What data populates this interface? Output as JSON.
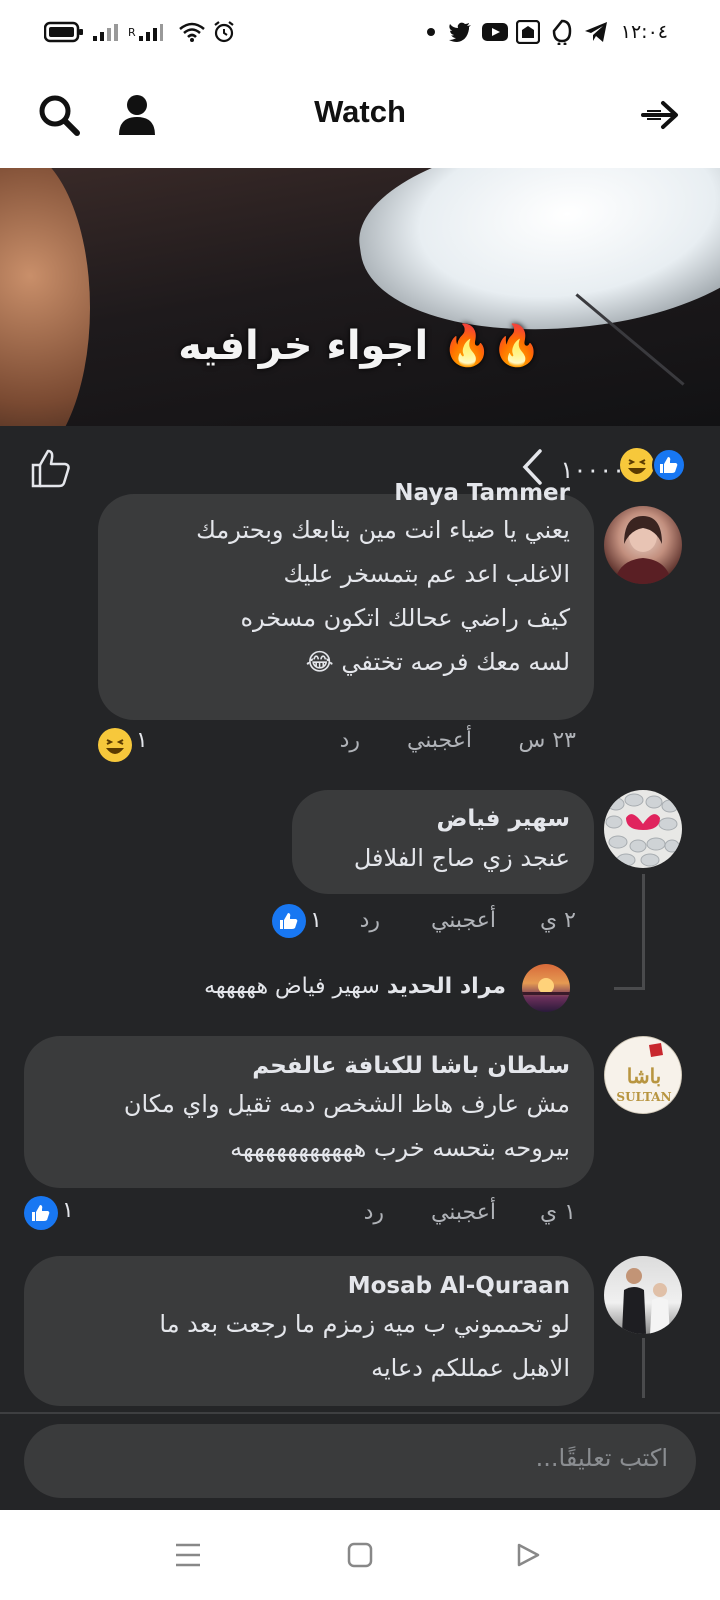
{
  "status_bar": {
    "time": "١٢:٠٤",
    "network_label": "R"
  },
  "header": {
    "title": "Watch"
  },
  "video": {
    "caption": "اجواء خرافيه"
  },
  "reactions": {
    "count": "١٠٠٠٠"
  },
  "comments": [
    {
      "author": "Naya Tammer",
      "lines": [
        "يعني يا ضياء انت مين بتابعك وبحترمك",
        "الاغلب اعد عم بتمسخر عليك",
        "كيف راضي عحالك اتكون مسخره",
        "لسه معك فرصه تختفي"
      ],
      "time": "٢٣ س",
      "like_label": "أعجبني",
      "reply_label": "رد",
      "reaction_count": "١"
    },
    {
      "author": "سهير فياض",
      "lines": [
        "عنجد زي صاج الفلافل"
      ],
      "time": "٢ ي",
      "like_label": "أعجبني",
      "reply_label": "رد",
      "reaction_count": "١",
      "reply": {
        "author": "مراد الحديد",
        "text": "سهير فياض هههههه"
      }
    },
    {
      "author": "سلطان باشا للكنافة عالفحم",
      "lines": [
        "مش عارف هاظ الشخص دمه ثقيل واي مكان",
        "بيروحه بتحسه خرب هههههههههههه"
      ],
      "time": "١ ي",
      "like_label": "أعجبني",
      "reply_label": "رد",
      "reaction_count": "١",
      "avatar_logo": "باشا SULTAN PASHA"
    },
    {
      "author": "Mosab Al-Quraan",
      "lines": [
        "لو تحمموني  ب ميه زمزم ما رجعت بعد ما",
        "الاهبل عمللكم دعايه"
      ]
    }
  ],
  "composer": {
    "placeholder": "اكتب تعليقًا..."
  },
  "colors": {
    "dark_bg": "#242527",
    "bubble": "#3a3b3c",
    "like_blue": "#1877f2",
    "haha_yellow": "#f7c83b"
  }
}
